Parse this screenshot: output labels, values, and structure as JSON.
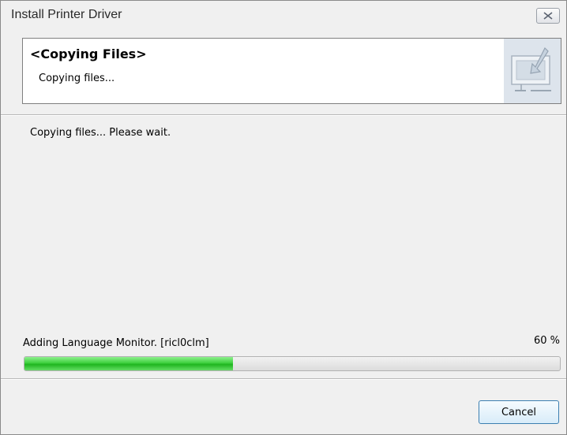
{
  "window": {
    "title": "Install Printer Driver",
    "close_icon": "close-icon"
  },
  "header": {
    "title": "<Copying Files>",
    "subtitle": "Copying files...",
    "icon": "install-monitor-icon"
  },
  "main": {
    "status_message": "Copying files... Please wait."
  },
  "progress": {
    "label": "Adding Language Monitor. [ricl0clm]",
    "percent_text": "60 %",
    "fraction": 0.39
  },
  "buttons": {
    "cancel_label": "Cancel"
  }
}
